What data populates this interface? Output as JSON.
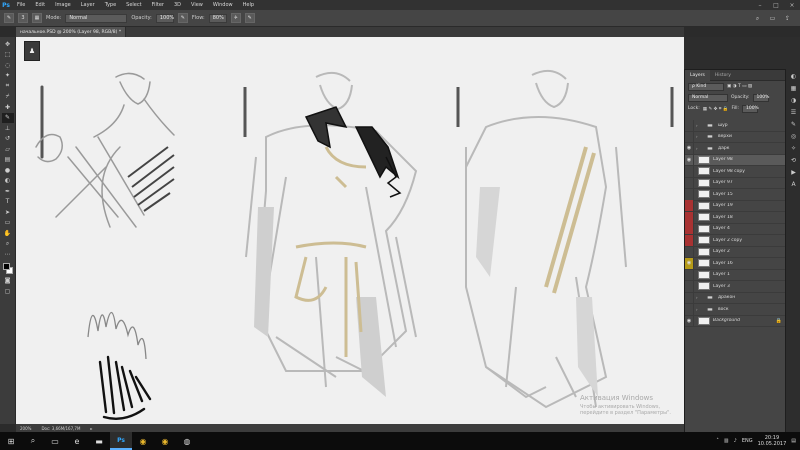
{
  "menubar": {
    "logo": "Ps",
    "items": [
      "File",
      "Edit",
      "Image",
      "Layer",
      "Type",
      "Select",
      "Filter",
      "3D",
      "View",
      "Window",
      "Help"
    ]
  },
  "options": {
    "size_value": "3",
    "mode_label": "Mode:",
    "mode_value": "Normal",
    "opacity_label": "Opacity:",
    "opacity_value": "100%",
    "flow_label": "Flow:",
    "flow_value": "80%"
  },
  "document": {
    "tab_title": "начальное.PSD @ 200% (Layer 98, RGB/8) *"
  },
  "status": {
    "zoom": "200%",
    "doc": "Doc: 3,66M/167,7M"
  },
  "watermark": {
    "title": "Активация Windows",
    "subtitle": "Чтобы активировать Windows, перейдите в раздел \"Параметры\"."
  },
  "layers_panel": {
    "tabs": [
      "Layers",
      "History"
    ],
    "kind_label": "ρ Kind",
    "blend_mode": "Normal",
    "opacity_label": "Opacity:",
    "opacity_value": "100%",
    "lock_label": "Lock:",
    "fill_label": "Fill:",
    "fill_value": "100%",
    "layers": [
      {
        "name": "шур",
        "type": "folder",
        "visible": false,
        "eye_color": ""
      },
      {
        "name": "верхи",
        "type": "folder",
        "visible": false,
        "eye_color": ""
      },
      {
        "name": "дарк",
        "type": "folder",
        "visible": true,
        "eye_color": ""
      },
      {
        "name": "Layer 98",
        "type": "layer",
        "visible": true,
        "eye_color": "",
        "selected": true
      },
      {
        "name": "Layer 98 copy",
        "type": "layer",
        "visible": false,
        "eye_color": ""
      },
      {
        "name": "Layer 97",
        "type": "layer",
        "visible": false,
        "eye_color": ""
      },
      {
        "name": "Layer 15",
        "type": "layer",
        "visible": false,
        "eye_color": ""
      },
      {
        "name": "Layer 19",
        "type": "layer",
        "visible": false,
        "eye_color": "red"
      },
      {
        "name": "Layer 18",
        "type": "layer",
        "visible": false,
        "eye_color": "red"
      },
      {
        "name": "Layer 4",
        "type": "layer",
        "visible": false,
        "eye_color": "red"
      },
      {
        "name": "Layer 2 copy",
        "type": "layer",
        "visible": false,
        "eye_color": "red"
      },
      {
        "name": "Layer 2",
        "type": "layer",
        "visible": false,
        "eye_color": ""
      },
      {
        "name": "Layer 16",
        "type": "layer",
        "visible": true,
        "eye_color": "yellow"
      },
      {
        "name": "Layer 1",
        "type": "layer",
        "visible": false,
        "eye_color": ""
      },
      {
        "name": "Layer 3",
        "type": "layer",
        "visible": false,
        "eye_color": ""
      },
      {
        "name": "дракон",
        "type": "folder",
        "visible": false,
        "eye_color": ""
      },
      {
        "name": "воск",
        "type": "folder",
        "visible": false,
        "eye_color": ""
      },
      {
        "name": "Background",
        "type": "background",
        "visible": true,
        "eye_color": ""
      }
    ]
  },
  "taskbar": {
    "lang": "ENG",
    "time": "20:19",
    "date": "10.05.2017"
  },
  "colors": {
    "ui_dark": "#3c3c3c",
    "canvas": "#f0f0f0",
    "gold": "#cdbd93",
    "accent": "#31a8ff"
  }
}
